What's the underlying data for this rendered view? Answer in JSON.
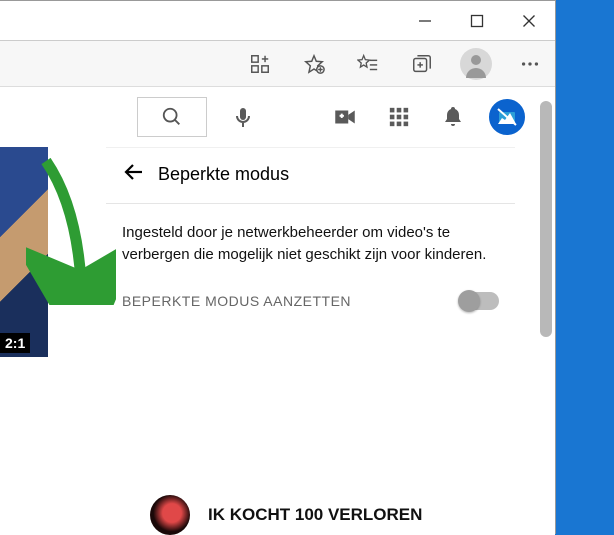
{
  "panel": {
    "title": "Beperkte modus",
    "description": "Ingesteld door je netwerkbeheerder om video's te verbergen die mogelijk niet geschikt zijn voor kinderen.",
    "toggle_label": "BEPERKTE MODUS AANZETTEN"
  },
  "thumbnail": {
    "duration": "2:1"
  },
  "feed": {
    "title": "IK KOCHT 100 VERLOREN"
  }
}
